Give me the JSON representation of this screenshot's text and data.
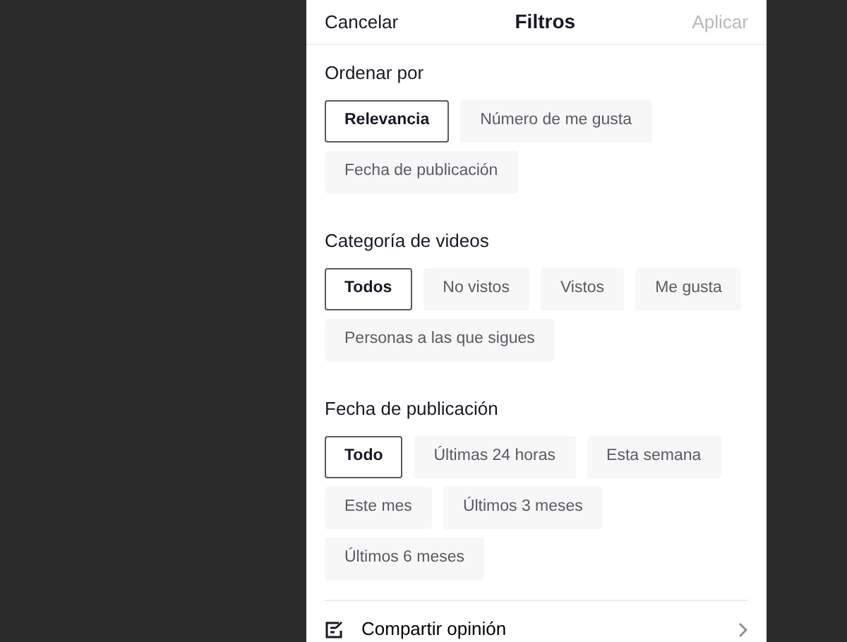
{
  "header": {
    "cancel": "Cancelar",
    "title": "Filtros",
    "apply": "Aplicar",
    "apply_disabled": true
  },
  "sections": [
    {
      "title": "Ordenar por",
      "options": [
        {
          "label": "Relevancia",
          "selected": true
        },
        {
          "label": "Número de me gusta",
          "selected": false
        },
        {
          "label": "Fecha de publicación",
          "selected": false
        }
      ]
    },
    {
      "title": "Categoría de videos",
      "options": [
        {
          "label": "Todos",
          "selected": true
        },
        {
          "label": "No vistos",
          "selected": false
        },
        {
          "label": "Vistos",
          "selected": false
        },
        {
          "label": "Me gusta",
          "selected": false
        },
        {
          "label": "Personas a las que sigues",
          "selected": false
        }
      ]
    },
    {
      "title": "Fecha de publicación",
      "options": [
        {
          "label": "Todo",
          "selected": true
        },
        {
          "label": "Últimas 24 horas",
          "selected": false
        },
        {
          "label": "Esta semana",
          "selected": false
        },
        {
          "label": "Este mes",
          "selected": false
        },
        {
          "label": "Últimos 3 meses",
          "selected": false
        },
        {
          "label": "Últimos 6 meses",
          "selected": false
        }
      ]
    }
  ],
  "footer": {
    "label": "Compartir opinión"
  }
}
